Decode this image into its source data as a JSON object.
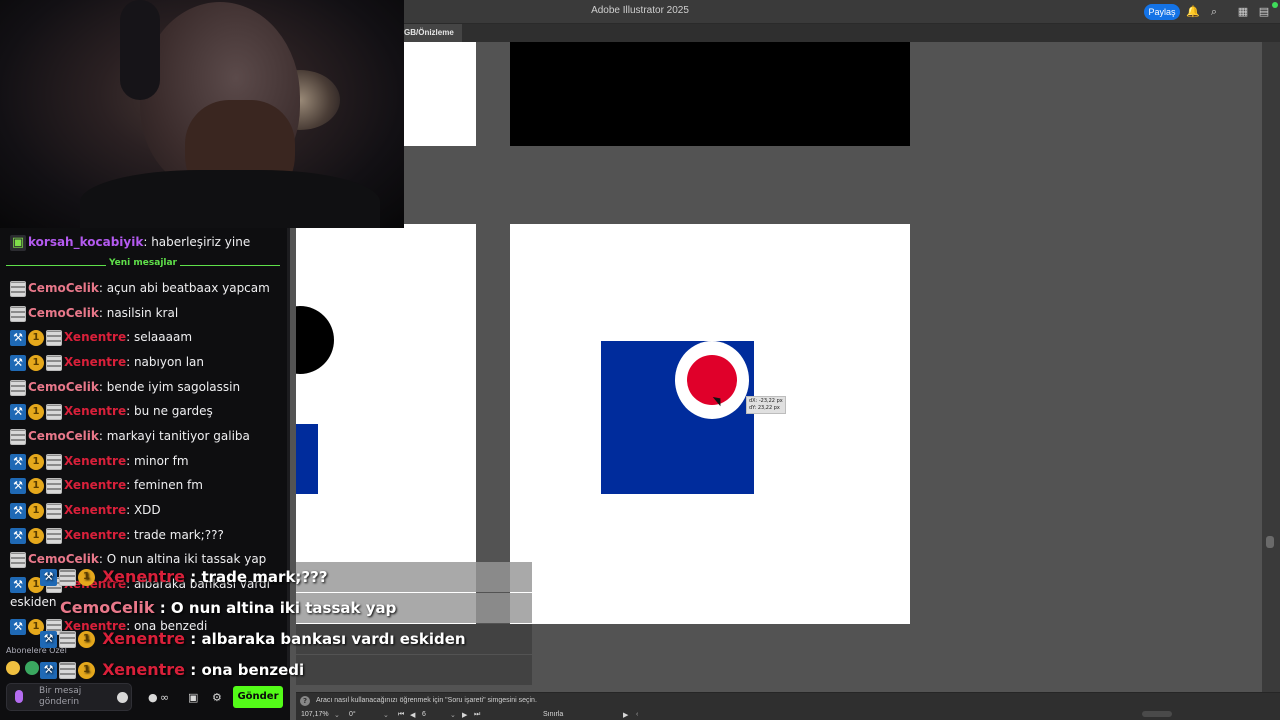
{
  "illustrator": {
    "title": "Adobe Illustrator 2025",
    "share_label": "Paylaş",
    "doc_tab": "GB/Önizleme",
    "status_message": "Aracı nasıl kullanacağınızı öğrenmek için \"Soru işareti\" simgesini seçin.",
    "zoom": "107,17%",
    "rotation": "0°",
    "artboard_number": "6",
    "status_mode": "Sınırla",
    "tooltip_dx": "dX: -23,22 px",
    "tooltip_dy": "dY: 23,22 px",
    "colors": {
      "blue": "#002c9c",
      "red": "#e0002a",
      "share": "#1473e6"
    }
  },
  "chat": {
    "pinned": {
      "user": "korsah_kocabiyik",
      "text": ": haberleşiriz yine"
    },
    "new_messages_label": "Yeni mesajlar",
    "messages": [
      {
        "user": "CemoCelik",
        "text": ": açun abi beatbaax yapcam"
      },
      {
        "user": "CemoCelik",
        "text": ": nasilsin kral"
      },
      {
        "user": "Xenentre",
        "text": ": selaaaam"
      },
      {
        "user": "Xenentre",
        "text": ": nabıyon lan"
      },
      {
        "user": "CemoCelik",
        "text": ": bende iyim sagolassin"
      },
      {
        "user": "Xenentre",
        "text": ": bu ne gardeş"
      },
      {
        "user": "CemoCelik",
        "text": ": markayi tanitiyor galiba"
      },
      {
        "user": "Xenentre",
        "text": ": minor fm"
      },
      {
        "user": "Xenentre",
        "text": ": feminen fm"
      },
      {
        "user": "Xenentre",
        "text": ": XDD"
      },
      {
        "user": "Xenentre",
        "text": ": trade mark;???"
      },
      {
        "user": "CemoCelik",
        "text": ": O nun altina iki tassak yap"
      },
      {
        "user": "Xenentre",
        "text": ": albaraka bankası vardı"
      },
      {
        "user": "",
        "text": "eskiden"
      },
      {
        "user": "Xenentre",
        "text": ": ona benzedi"
      }
    ],
    "subscribers_only": "Abonelere Özel",
    "input_placeholder_1": "Bir mesaj",
    "input_placeholder_2": "gönderin",
    "send_label": "Gönder",
    "infinity": "∞"
  },
  "overlay": [
    {
      "user": "Xenentre",
      "text": ": trade mark;???"
    },
    {
      "user": "CemoCelik",
      "text": ": O nun altina iki tassak yap"
    },
    {
      "user": "Xenentre",
      "text": ": albaraka bankası vardı eskiden"
    },
    {
      "user": "Xenentre",
      "text": ": ona benzedi"
    }
  ]
}
